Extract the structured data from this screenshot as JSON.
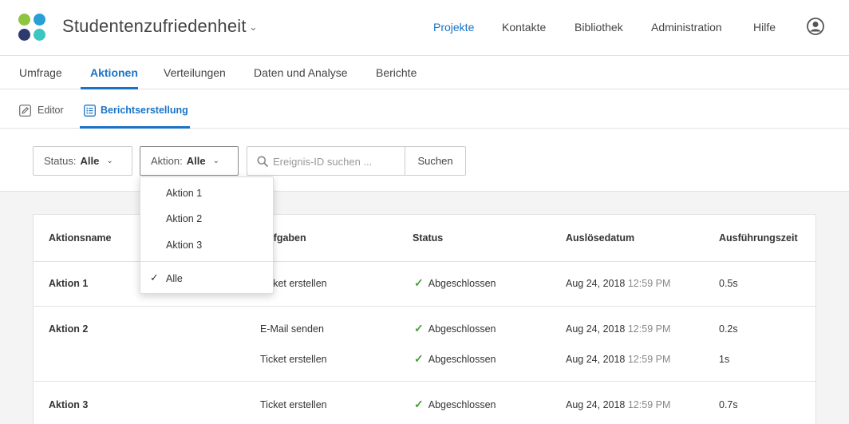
{
  "header": {
    "project_title": "Studentenzufriedenheit",
    "nav": [
      "Projekte",
      "Kontakte",
      "Bibliothek",
      "Administration",
      "Hilfe"
    ],
    "active_nav": "Projekte"
  },
  "tabs": [
    "Umfrage",
    "Aktionen",
    "Verteilungen",
    "Daten und Analyse",
    "Berichte"
  ],
  "active_tab": "Aktionen",
  "subtabs": [
    "Editor",
    "Berichtserstellung"
  ],
  "active_subtab": "Berichtserstellung",
  "filters": {
    "status_label": "Status:",
    "status_value": "Alle",
    "action_label": "Aktion:",
    "action_value": "Alle",
    "search_placeholder": "Ereignis-ID suchen ...",
    "search_button": "Suchen"
  },
  "dropdown": {
    "items": [
      "Aktion 1",
      "Aktion 2",
      "Aktion 3"
    ],
    "selected": "Alle"
  },
  "table": {
    "columns": [
      "Aktionsname",
      "Aufgaben",
      "Status",
      "Auslösedatum",
      "Ausführungszeit"
    ],
    "rows": [
      {
        "name": "Aktion 1",
        "task": "Ticket erstellen",
        "status": "Abgeschlossen",
        "date": "Aug 24, 2018",
        "time": "12:59 PM",
        "duration": "0.5s"
      },
      {
        "name": "Aktion 2",
        "task": "E-Mail senden",
        "status": "Abgeschlossen",
        "date": "Aug 24, 2018",
        "time": "12:59 PM",
        "duration": "0.2s"
      },
      {
        "name": "",
        "task": "Ticket erstellen",
        "status": "Abgeschlossen",
        "date": "Aug 24, 2018",
        "time": "12:59 PM",
        "duration": "1s"
      },
      {
        "name": "Aktion 3",
        "task": "Ticket erstellen",
        "status": "Abgeschlossen",
        "date": "Aug 24, 2018",
        "time": "12:59 PM",
        "duration": "0.7s"
      }
    ]
  },
  "colors": {
    "accent": "#1a73c7",
    "success": "#4a9f3a"
  },
  "icons": [
    "qualtrics-logo-icon",
    "chevron-down-icon",
    "user-avatar-icon",
    "pencil-icon",
    "list-report-icon",
    "search-icon",
    "checkmark-icon"
  ]
}
